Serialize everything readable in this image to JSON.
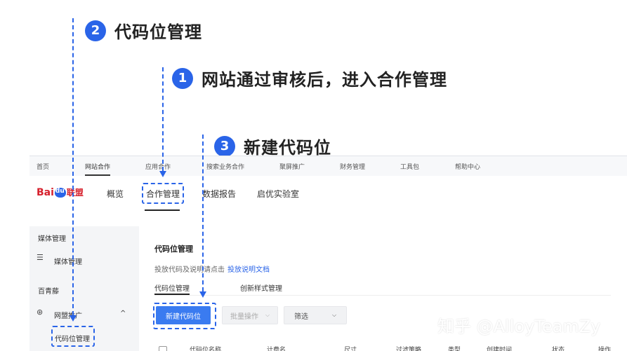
{
  "annotations": {
    "step2": {
      "num": "2",
      "text": "代码位管理"
    },
    "step1": {
      "num": "1",
      "text": "网站通过审核后，进入合作管理"
    },
    "step3": {
      "num": "3",
      "text": "新建代码位"
    }
  },
  "topnav": [
    "首页",
    "网站合作",
    "应用合作",
    "搜索业务合作",
    "聚屏推广",
    "财务管理",
    "工具包",
    "帮助中心"
  ],
  "brand": {
    "bai": "Bai",
    "du": "du",
    "lm": "联盟"
  },
  "mainnav": [
    "概览",
    "合作管理",
    "数据报告",
    "启优实验室"
  ],
  "sidebar": {
    "group1": "媒体管理",
    "item1": "媒体管理",
    "group2": "百青藤",
    "item2": "网盟推广",
    "item2_chevron": "^",
    "item3": "代码位管理"
  },
  "content": {
    "title": "代码位管理",
    "desc": "投放代码及说明请点击",
    "desc_link": "投放说明文档",
    "tabs": [
      "代码位管理",
      "创新样式管理"
    ],
    "buttons": {
      "new": "新建代码位",
      "batch": "批量操作",
      "filter": "筛选"
    },
    "table_headers": [
      "代码位名称",
      "计费名",
      "尺寸",
      "过滤策略",
      "类型",
      "创建时间",
      "状态",
      "操作"
    ]
  },
  "watermark": "知乎 @AlloyTeamZy",
  "colors": {
    "accent": "#2a64e8",
    "brand_red": "#d6202c",
    "primary_button": "#3a7bf0"
  }
}
